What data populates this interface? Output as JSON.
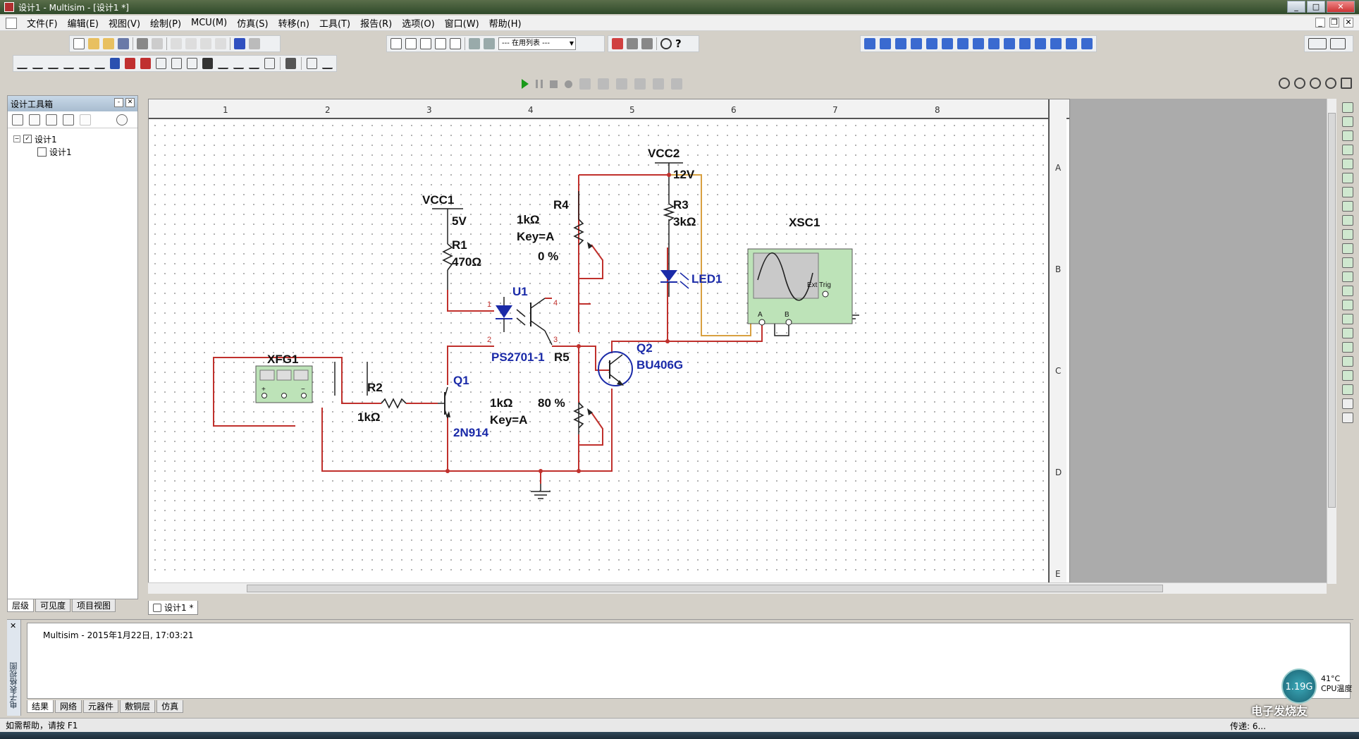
{
  "window": {
    "title": "设计1 - Multisim - [设计1 *]"
  },
  "menu": [
    "文件(F)",
    "编辑(E)",
    "视图(V)",
    "绘制(P)",
    "MCU(M)",
    "仿真(S)",
    "转移(n)",
    "工具(T)",
    "报告(R)",
    "选项(O)",
    "窗口(W)",
    "帮助(H)"
  ],
  "toolbar": {
    "in_use_list": "--- 在用列表 ---"
  },
  "design_toolbox": {
    "title": "设计工具箱",
    "tree_root": "设计1",
    "tree_child": "设计1",
    "tabs": [
      "层级",
      "可见度",
      "项目视图"
    ]
  },
  "ruler": {
    "top": [
      "1",
      "2",
      "3",
      "4",
      "5",
      "6",
      "7",
      "8"
    ],
    "right": [
      "A",
      "B",
      "C",
      "D",
      "E"
    ]
  },
  "schematic": {
    "vcc2_name": "VCC2",
    "vcc2_value": "12V",
    "vcc1_name": "VCC1",
    "vcc1_value": "5V",
    "r1_name": "R1",
    "r1_value": "470Ω",
    "r2_name": "R2",
    "r2_value": "1kΩ",
    "r3_name": "R3",
    "r3_value": "3kΩ",
    "r4_name": "R4",
    "r4_value": "1kΩ",
    "r4_key": "Key=A",
    "r4_pct": "0 %",
    "r5_name": "R5",
    "r5_value": "1kΩ",
    "r5_key": "Key=A",
    "r5_pct": "80 %",
    "u1_name": "U1",
    "u1_part": "PS2701-1",
    "pin1": "1",
    "pin2": "2",
    "pin3": "3",
    "pin4": "4",
    "q1_name": "Q1",
    "q1_part": "2N914",
    "q2_name": "Q2",
    "q2_part": "BU406G",
    "led_name": "LED1",
    "xsc_name": "XSC1",
    "xsc_trig": "Ext Trig",
    "xsc_a": "A",
    "xsc_b": "B",
    "xfg_name": "XFG1",
    "xfg_plus": "+",
    "xfg_minus": "−",
    "wire_red": "#c0302c",
    "wire_orange": "#d8a040",
    "part_blue": "#1a2aa8"
  },
  "doc_tab": "设计1 *",
  "output": {
    "side_label": "电子表格视图",
    "log": "Multisim  -  2015年1月22日, 17:03:21",
    "tabs": [
      "结果",
      "网络",
      "元器件",
      "敷铜层",
      "仿真"
    ]
  },
  "status": {
    "help": "如需帮助，请按 F1",
    "transfer": "传递: 6..."
  },
  "widget": {
    "cpu_value": "1.19G",
    "temp": "41°C",
    "temp_label": "CPU温度",
    "watermark": "电子发烧友"
  }
}
